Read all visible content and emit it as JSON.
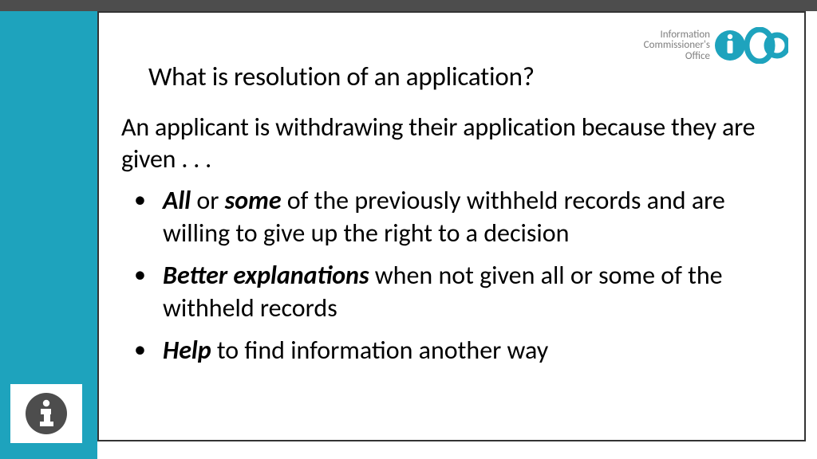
{
  "brand": {
    "name_line1": "Information",
    "name_line2": "Commissioner's",
    "name_line3": "Office",
    "accent": "#1ea3bd"
  },
  "title": "What is resolution of an application?",
  "lead": "An applicant is withdrawing their application because they are given . . .",
  "bullets": [
    {
      "bold1": "All",
      "mid": " or ",
      "bold2": "some",
      "rest": " of the previously withheld records and are willing to give up the right to a decision"
    },
    {
      "bold1": "Better explanations",
      "mid": "",
      "bold2": "",
      "rest": " when not given all or some of the withheld records"
    },
    {
      "bold1": "Help",
      "mid": "",
      "bold2": "",
      "rest": " to find information another way"
    }
  ]
}
